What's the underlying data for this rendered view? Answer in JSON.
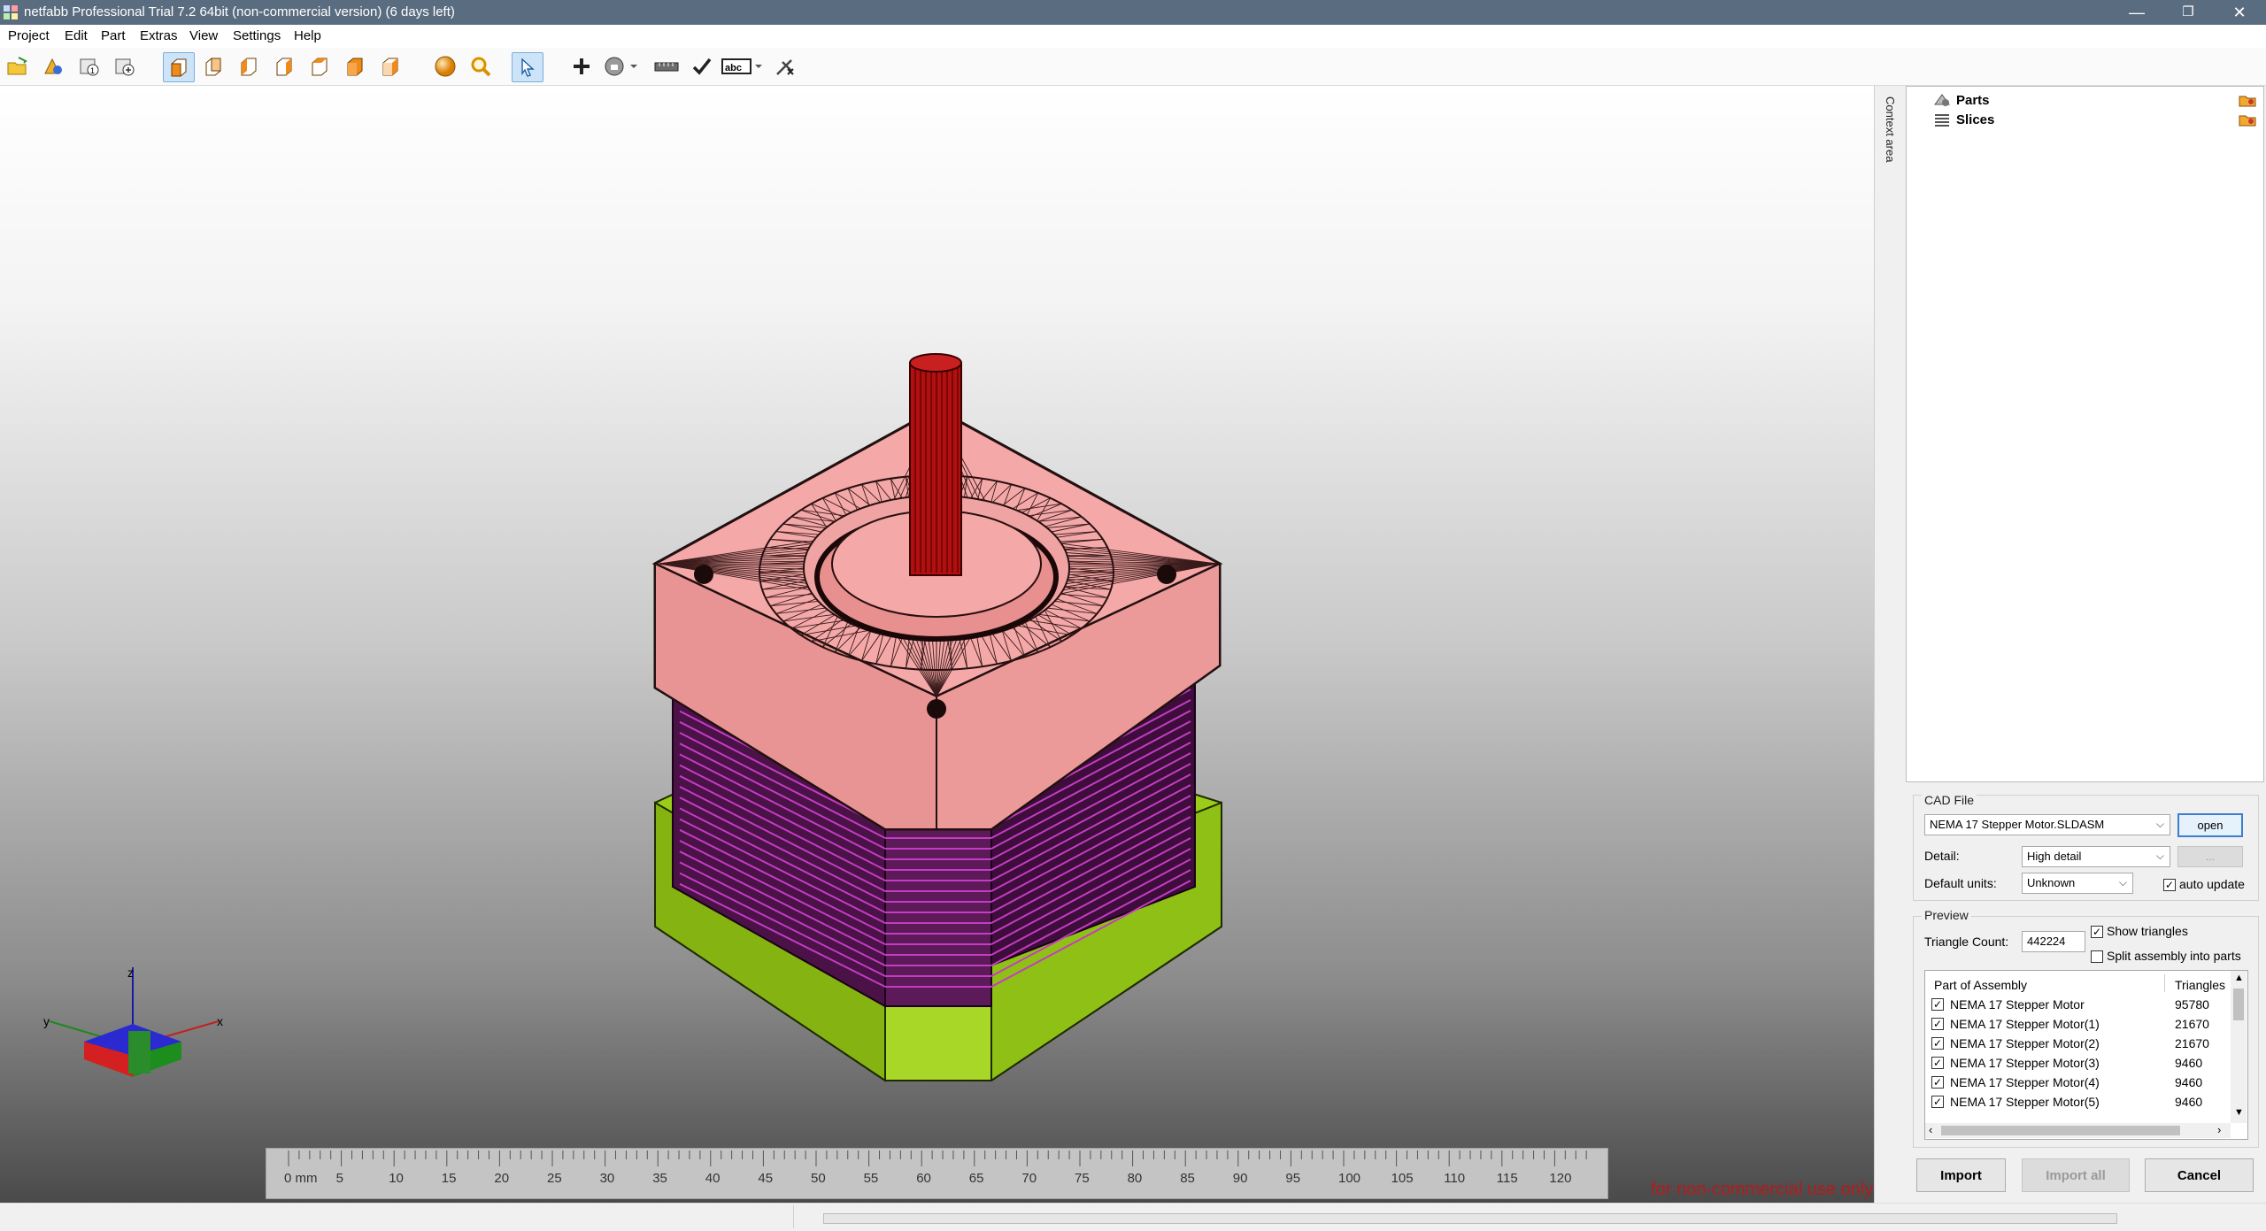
{
  "window": {
    "title": "netfabb Professional Trial 7.2 64bit (non-commercial version) (6 days left)",
    "minimize_glyph": "—",
    "maximize_glyph": "❐",
    "close_glyph": "✕"
  },
  "menu": [
    "Project",
    "Edit",
    "Part",
    "Extras",
    "View",
    "Settings",
    "Help"
  ],
  "toolbar": {
    "icons": [
      "open-project-icon",
      "add-part-icon",
      "new-project-icon",
      "add-project-icon",
      "view-front-icon",
      "view-back-icon",
      "view-left-icon",
      "view-right-icon",
      "view-top-icon",
      "view-bottom-icon",
      "sphere-icon",
      "zoom-icon",
      "select-pointer-icon",
      "move-icon",
      "repair-icon",
      "measure-icon",
      "check-icon",
      "label-icon",
      "settings-tool-icon"
    ],
    "label_text": "abc"
  },
  "viewport": {
    "axis_labels": {
      "x": "x",
      "y": "y",
      "z": "z"
    },
    "ruler": {
      "unit": "mm",
      "ticks": [
        "0 mm",
        "5",
        "10",
        "15",
        "20",
        "25",
        "30",
        "35",
        "40",
        "45",
        "50",
        "55",
        "60",
        "65",
        "70",
        "75",
        "80",
        "85",
        "90",
        "95",
        "100",
        "105",
        "110",
        "115",
        "120"
      ]
    },
    "watermark": "for non-commercial use only"
  },
  "context_tab": {
    "label": "Context area"
  },
  "tree": {
    "items": [
      {
        "label": "Parts"
      },
      {
        "label": "Slices"
      }
    ]
  },
  "cad": {
    "group_label": "CAD File",
    "file": "NEMA 17 Stepper Motor.SLDASM",
    "open_label": "open",
    "browse_label": "...",
    "detail_label": "Detail:",
    "detail_value": "High detail",
    "units_label": "Default units:",
    "units_value": "Unknown",
    "auto_update_label": "auto update",
    "auto_update": true
  },
  "preview": {
    "group_label": "Preview",
    "triangle_count_label": "Triangle Count:",
    "triangle_count": "442224",
    "show_triangles_label": "Show triangles",
    "show_triangles": true,
    "split_label": "Split assembly into parts",
    "split": false
  },
  "assembly": {
    "col_part": "Part of Assembly",
    "col_triangles": "Triangles",
    "rows": [
      {
        "name": "NEMA 17 Stepper Motor",
        "triangles": "95780"
      },
      {
        "name": "NEMA 17 Stepper Motor(1)",
        "triangles": "21670"
      },
      {
        "name": "NEMA 17 Stepper Motor(2)",
        "triangles": "21670"
      },
      {
        "name": "NEMA 17 Stepper Motor(3)",
        "triangles": "9460"
      },
      {
        "name": "NEMA 17 Stepper Motor(4)",
        "triangles": "9460"
      },
      {
        "name": "NEMA 17 Stepper Motor(5)",
        "triangles": "9460"
      }
    ]
  },
  "buttons": {
    "import": "Import",
    "import_all": "Import all",
    "cancel": "Cancel"
  },
  "colors": {
    "titlebar": "#5a6d80",
    "motor_top": "#f2a0a0",
    "motor_shaft": "#b01010",
    "motor_body": "#6b1f6b",
    "motor_base": "#9bcc1a",
    "watermark": "#b41b1b",
    "accent": "#3c7fd1"
  }
}
